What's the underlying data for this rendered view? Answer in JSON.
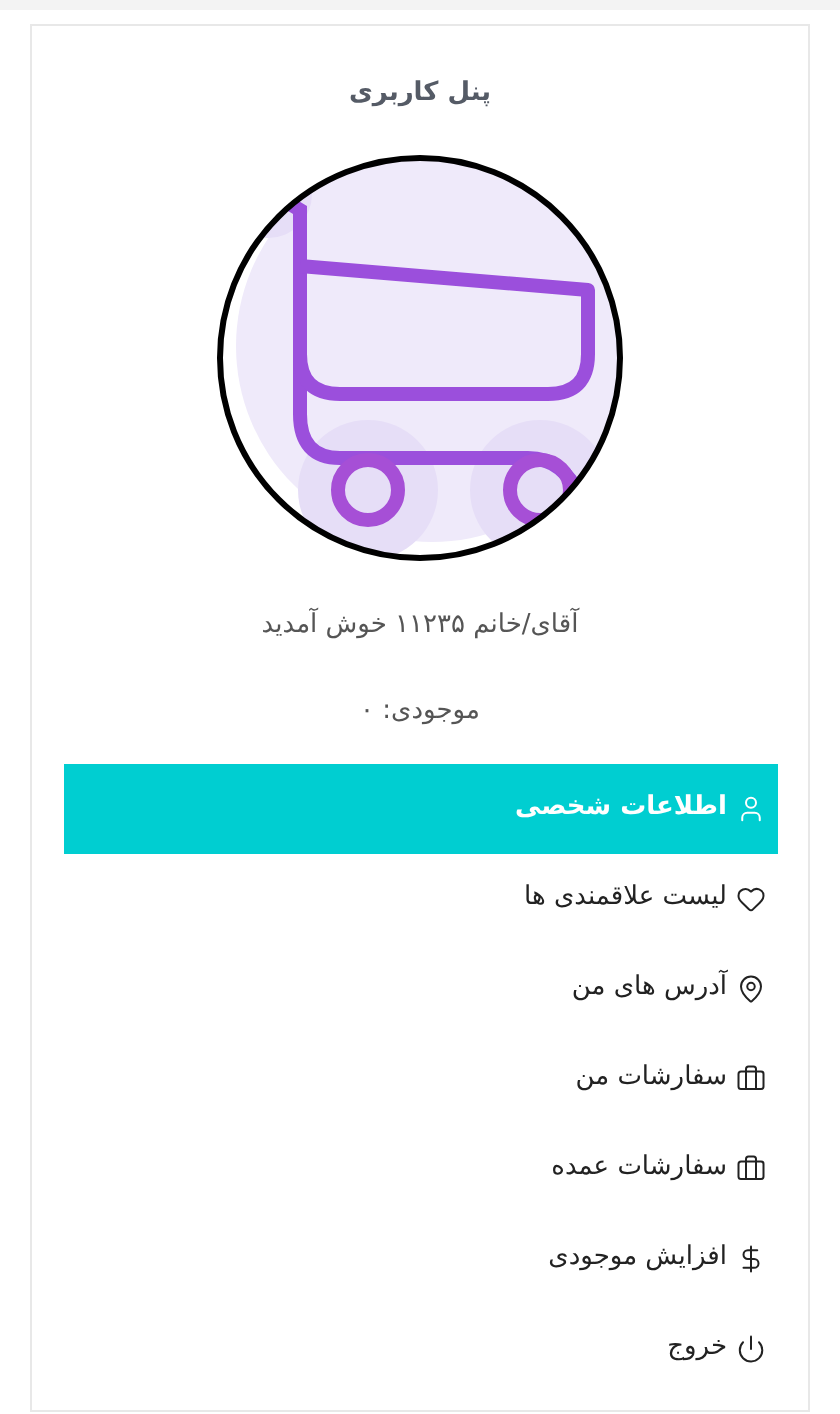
{
  "panel": {
    "title": "پنل کاربری",
    "welcome": "آقای/خانم ۱۱۲۳۵ خوش آمدید",
    "balance": "موجودی: ۰"
  },
  "menu": [
    {
      "label": "اطلاعات شخصی",
      "selected": true
    },
    {
      "label": "لیست علاقمندی ها",
      "selected": false
    },
    {
      "label": "آدرس های من",
      "selected": false
    },
    {
      "label": "سفارشات من",
      "selected": false
    },
    {
      "label": "سفارشات عمده",
      "selected": false
    },
    {
      "label": "افزایش موجودی",
      "selected": false
    },
    {
      "label": "خروج",
      "selected": false
    }
  ]
}
